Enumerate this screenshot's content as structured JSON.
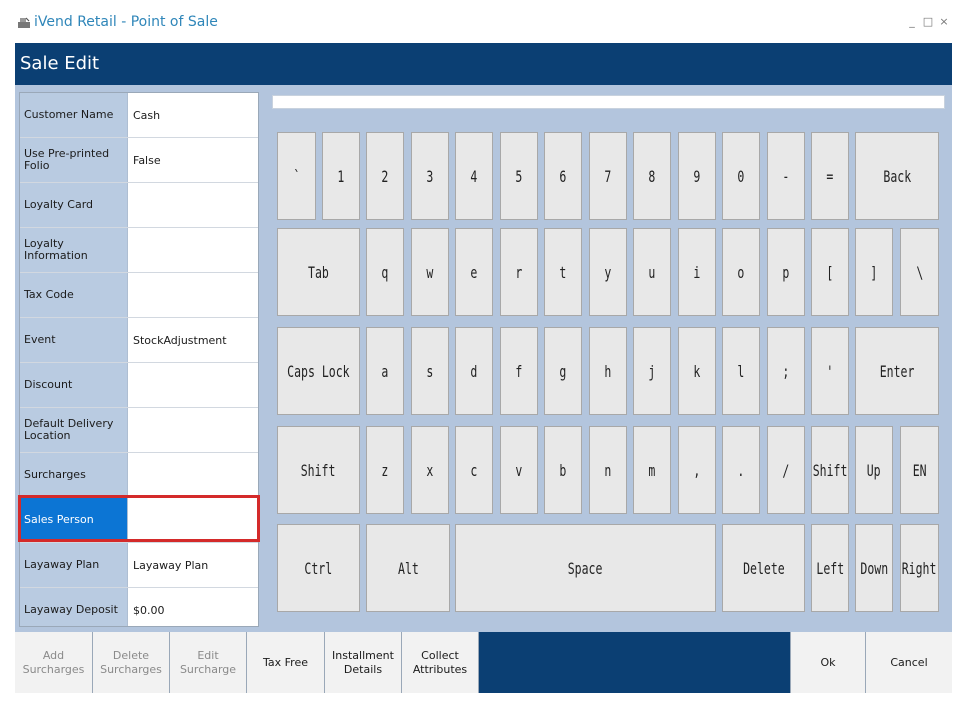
{
  "window": {
    "title": "iVend Retail - Point of Sale",
    "minimize": "_",
    "maximize": "□",
    "close": "×"
  },
  "header": {
    "title": "Sale Edit"
  },
  "properties": [
    {
      "label": "Customer Name",
      "value": "Cash"
    },
    {
      "label": "Use Pre-printed Folio",
      "value": "False"
    },
    {
      "label": "Loyalty Card",
      "value": ""
    },
    {
      "label": "Loyalty Information",
      "value": ""
    },
    {
      "label": "Tax Code",
      "value": ""
    },
    {
      "label": "Event",
      "value": "StockAdjustment"
    },
    {
      "label": "Discount",
      "value": ""
    },
    {
      "label": "Default Delivery Location",
      "value": ""
    },
    {
      "label": "Surcharges",
      "value": ""
    },
    {
      "label": "Sales Person",
      "value": "",
      "selected": true
    },
    {
      "label": "Layaway Plan",
      "value": "Layaway Plan"
    },
    {
      "label": "Layaway Deposit",
      "value": "$0.00"
    }
  ],
  "keyboard": {
    "input_value": "",
    "row1": [
      "`",
      "1",
      "2",
      "3",
      "4",
      "5",
      "6",
      "7",
      "8",
      "9",
      "0",
      "-",
      "=",
      "Back"
    ],
    "row2": [
      "Tab",
      "q",
      "w",
      "e",
      "r",
      "t",
      "y",
      "u",
      "i",
      "o",
      "p",
      "[",
      "]",
      "\\"
    ],
    "row3": [
      "Caps Lock",
      "a",
      "s",
      "d",
      "f",
      "g",
      "h",
      "j",
      "k",
      "l",
      ";",
      "'",
      "Enter"
    ],
    "row4": [
      "Shift",
      "z",
      "x",
      "c",
      "v",
      "b",
      "n",
      "m",
      ",",
      ".",
      "/",
      "Shift",
      "Up",
      "EN"
    ],
    "row5": [
      "Ctrl",
      "Alt",
      "Space",
      "Delete",
      "Left",
      "Down",
      "Right"
    ]
  },
  "footer": {
    "add_surcharges": "Add Surcharges",
    "delete_surcharges": "Delete Surcharges",
    "edit_surcharge": "Edit Surcharge",
    "tax_free": "Tax Free",
    "installment_details": "Installment Details",
    "collect_attributes": "Collect Attributes",
    "ok": "Ok",
    "cancel": "Cancel"
  },
  "colors": {
    "header_bg": "#0b3f73",
    "panel_bg": "#b3c5dd",
    "selected_bg": "#0c75d4",
    "highlight": "#d42a2a",
    "title_text": "#2f86b9"
  }
}
